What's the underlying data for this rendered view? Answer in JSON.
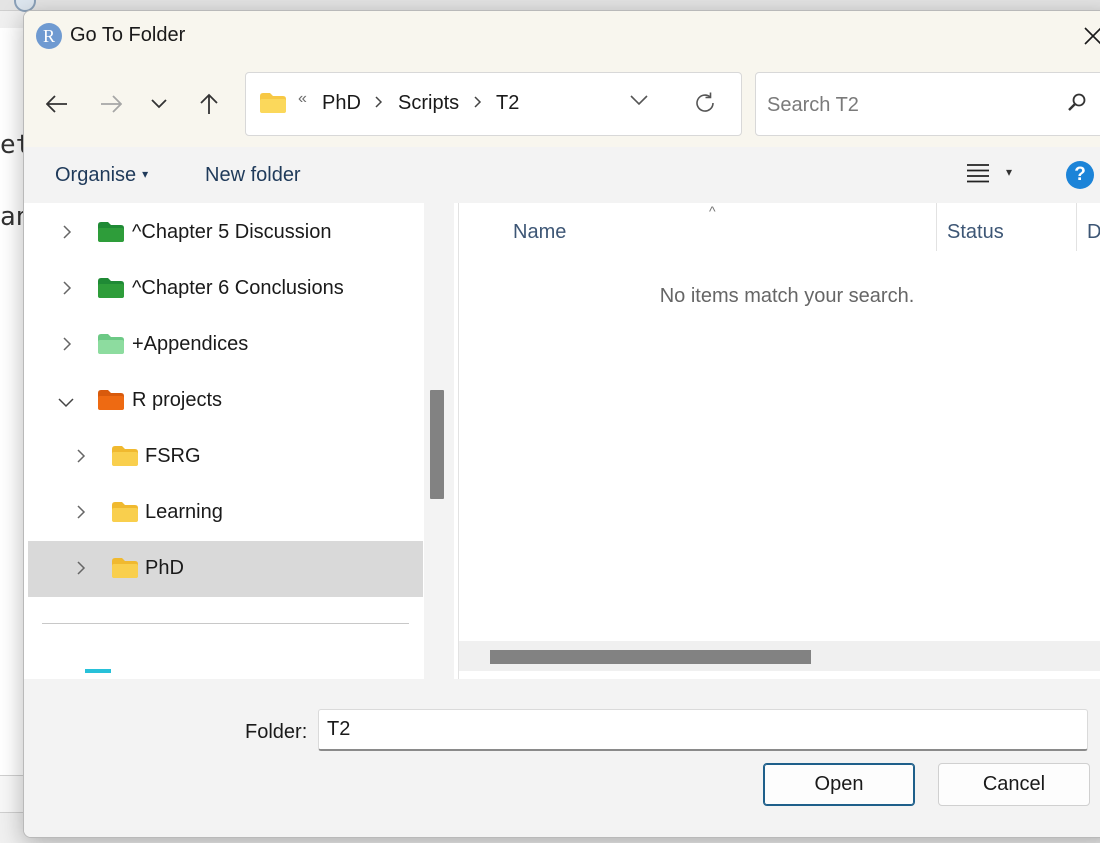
{
  "dialog": {
    "title": "Go To Folder",
    "app_icon_letter": "R"
  },
  "navigation": {
    "back_icon": "arrow-left-icon",
    "forward_icon": "arrow-right-icon",
    "recent_icon": "chevron-down-icon",
    "up_icon": "arrow-up-icon"
  },
  "address_bar": {
    "overflow_glyph": "«",
    "breadcrumbs": [
      "PhD",
      "Scripts",
      "T2"
    ]
  },
  "search": {
    "placeholder": "Search T2"
  },
  "toolbar": {
    "organise_label": "Organise",
    "organise_caret": "▾",
    "new_folder_label": "New folder",
    "help_label": "?"
  },
  "tree": {
    "items": [
      {
        "label": "^Chapter 5 Discussion",
        "state": "collapsed",
        "folder_color": "#2e9d3a"
      },
      {
        "label": "^Chapter 6 Conclusions",
        "state": "collapsed",
        "folder_color": "#2e9d3a"
      },
      {
        "label": "+Appendices",
        "state": "collapsed",
        "folder_color": "#7fd596"
      },
      {
        "label": "R projects",
        "state": "expanded",
        "folder_color": "#ee6a12"
      },
      {
        "label": "FSRG",
        "state": "collapsed",
        "folder_color": "#f9cf4d"
      },
      {
        "label": "Learning",
        "state": "collapsed",
        "folder_color": "#f9cf4d"
      },
      {
        "label": "PhD",
        "state": "collapsed",
        "folder_color": "#f9cf4d",
        "selected": true
      }
    ]
  },
  "file_list": {
    "columns": [
      "Name",
      "Status",
      "D"
    ],
    "sort_indicator": "^",
    "empty_message": "No items match your search."
  },
  "footer": {
    "folder_label": "Folder:",
    "folder_value": "T2",
    "open_label": "Open",
    "cancel_label": "Cancel"
  },
  "background_app": {
    "code_fragments": [
      "et",
      "an"
    ]
  },
  "colors": {
    "accent": "#1c84d8",
    "titlebar": "#f8f6ee",
    "selection": "#d9d9d9"
  }
}
